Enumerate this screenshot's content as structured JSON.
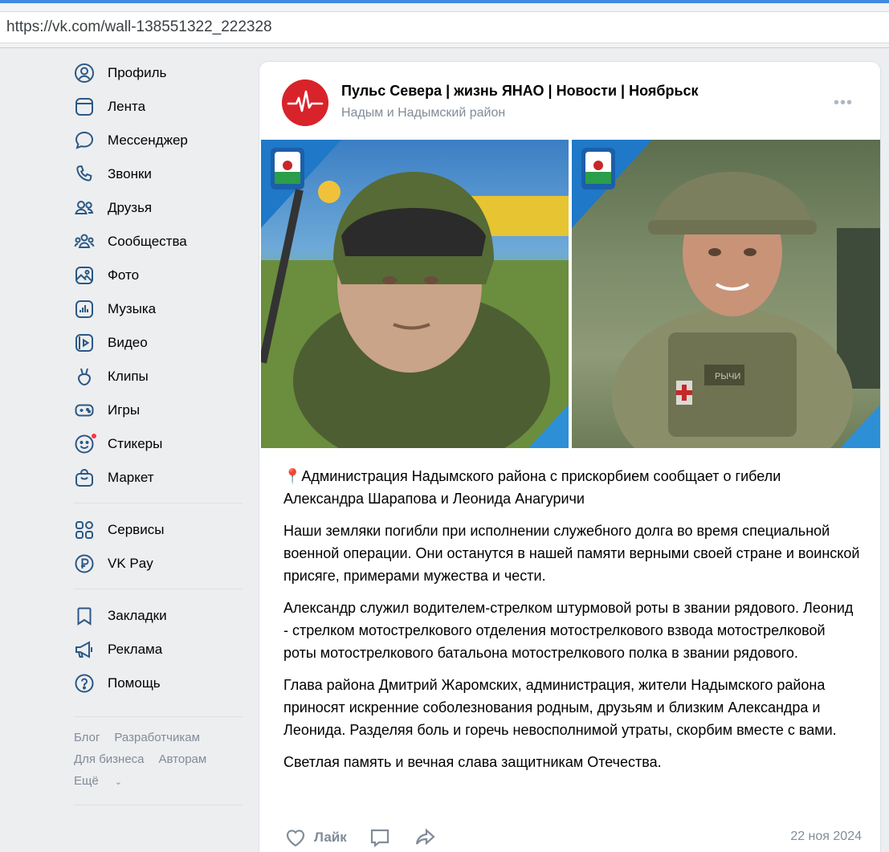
{
  "browser": {
    "url": "https://vk.com/wall-138551322_222328"
  },
  "colors": {
    "accent": "#3f8ae0",
    "sidebar_icon": "#2a5885",
    "muted": "#818c99",
    "brand_red": "#d8232a",
    "badge": "#ff3347"
  },
  "sidebar": {
    "items": [
      {
        "label": "Профиль",
        "icon": "profile-icon"
      },
      {
        "label": "Лента",
        "icon": "feed-icon"
      },
      {
        "label": "Мессенджер",
        "icon": "messenger-icon"
      },
      {
        "label": "Звонки",
        "icon": "phone-icon"
      },
      {
        "label": "Друзья",
        "icon": "friends-icon"
      },
      {
        "label": "Сообщества",
        "icon": "communities-icon"
      },
      {
        "label": "Фото",
        "icon": "photo-icon"
      },
      {
        "label": "Музыка",
        "icon": "music-icon"
      },
      {
        "label": "Видео",
        "icon": "video-icon"
      },
      {
        "label": "Клипы",
        "icon": "clips-icon"
      },
      {
        "label": "Игры",
        "icon": "games-icon"
      },
      {
        "label": "Стикеры",
        "icon": "stickers-icon"
      },
      {
        "label": "Маркет",
        "icon": "market-icon"
      }
    ],
    "group2": [
      {
        "label": "Сервисы",
        "icon": "services-icon"
      },
      {
        "label": "VK Pay",
        "icon": "vkpay-icon"
      }
    ],
    "group3": [
      {
        "label": "Закладки",
        "icon": "bookmark-icon"
      },
      {
        "label": "Реклама",
        "icon": "megaphone-icon"
      },
      {
        "label": "Помощь",
        "icon": "help-icon"
      }
    ],
    "footer": {
      "blog": "Блог",
      "developers": "Разработчикам",
      "business": "Для бизнеса",
      "authors": "Авторам",
      "more": "Ещё"
    }
  },
  "post": {
    "group_name": "Пульс Севера | жизнь ЯНАО | Новости | Ноябрьск",
    "location": "Надым и Надымский район",
    "paragraphs": [
      "📍Администрация Надымского района с прискорбием сообщает о гибели Александра Шарапова и Леонида Анагуричи",
      "Наши земляки погибли при исполнении служебного долга во время специальной военной операции. Они останутся в нашей памяти верными своей стране и воинской присяге, примерами мужества и чести.",
      "Александр служил водителем-стрелком штурмовой роты в звании рядового. Леонид - стрелком мотострелкового отделения мотострелкового взвода мотострелковой роты мотострелкового батальона мотострелкового полка в звании рядового.",
      "Глава района Дмитрий Жаромских, администрация, жители Надымского района приносят искренние соболезнования родным, друзьям и близким Александра и Леонида. Разделяя боль и горечь невосполнимой утраты, скорбим вместе с вами.",
      "Светлая память и вечная слава защитникам Отечества."
    ],
    "like_label": "Лайк",
    "date": "22 ноя 2024",
    "photo_patch_label": "РЫЧИ"
  }
}
